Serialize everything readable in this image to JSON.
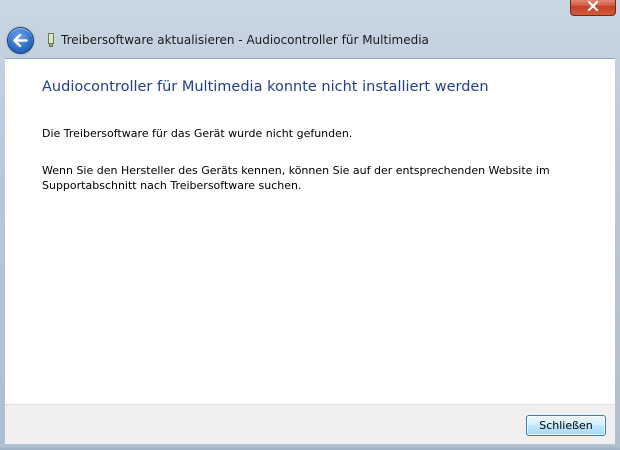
{
  "window": {
    "title": "Treibersoftware aktualisieren - Audiocontroller für Multimedia"
  },
  "content": {
    "heading": "Audiocontroller für Multimedia konnte nicht installiert werden",
    "message_1": "Die Treibersoftware für das Gerät wurde nicht gefunden.",
    "message_2": "Wenn Sie den Hersteller des Geräts kennen, können Sie auf der entsprechenden Website im Supportabschnitt nach Treibersoftware suchen."
  },
  "footer": {
    "close_label": "Schließen"
  },
  "icons": {
    "back": "back-arrow-icon",
    "device": "device-icon",
    "close": "close-icon"
  },
  "colors": {
    "heading": "#1e3f93",
    "close_button": "#c53f23",
    "back_button": "#2f6fc8"
  }
}
